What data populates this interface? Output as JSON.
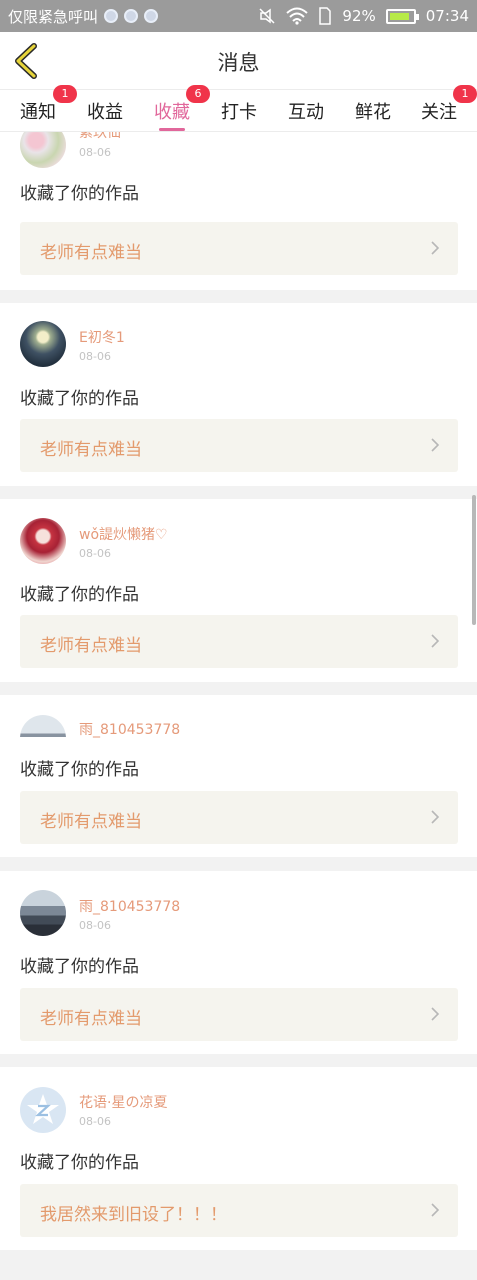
{
  "status_bar": {
    "carrier": "仅限紧急呼叫",
    "battery": "92%",
    "time": "07:34"
  },
  "header": {
    "title": "消息"
  },
  "tabs": [
    {
      "label": "通知",
      "badge": "1"
    },
    {
      "label": "收益",
      "badge": ""
    },
    {
      "label": "收藏",
      "badge": "6"
    },
    {
      "label": "打卡",
      "badge": ""
    },
    {
      "label": "互动",
      "badge": ""
    },
    {
      "label": "鲜花",
      "badge": ""
    },
    {
      "label": "关注",
      "badge": "1"
    }
  ],
  "feed": [
    {
      "username": "紫玖仙",
      "date": "08-06",
      "action": "收藏了你的作品",
      "work": "老师有点难当",
      "avatar": "pink-flowers"
    },
    {
      "username": "E初冬1",
      "date": "08-06",
      "action": "收藏了你的作品",
      "work": "老师有点难当",
      "avatar": "doll"
    },
    {
      "username": "wǒ諟炏懒猪♡",
      "date": "08-06",
      "action": "收藏了你的作品",
      "work": "老师有点难当",
      "avatar": "girl"
    },
    {
      "username": "雨_810453778",
      "date": "",
      "action": "收藏了你的作品",
      "work": "老师有点难当",
      "avatar": "city"
    },
    {
      "username": "雨_810453778",
      "date": "08-06",
      "action": "收藏了你的作品",
      "work": "老师有点难当",
      "avatar": "city"
    },
    {
      "username": "花语·星の凉夏",
      "date": "08-06",
      "action": "收藏了你的作品",
      "work": "我居然来到旧设了！！！",
      "avatar": "default-z"
    }
  ]
}
